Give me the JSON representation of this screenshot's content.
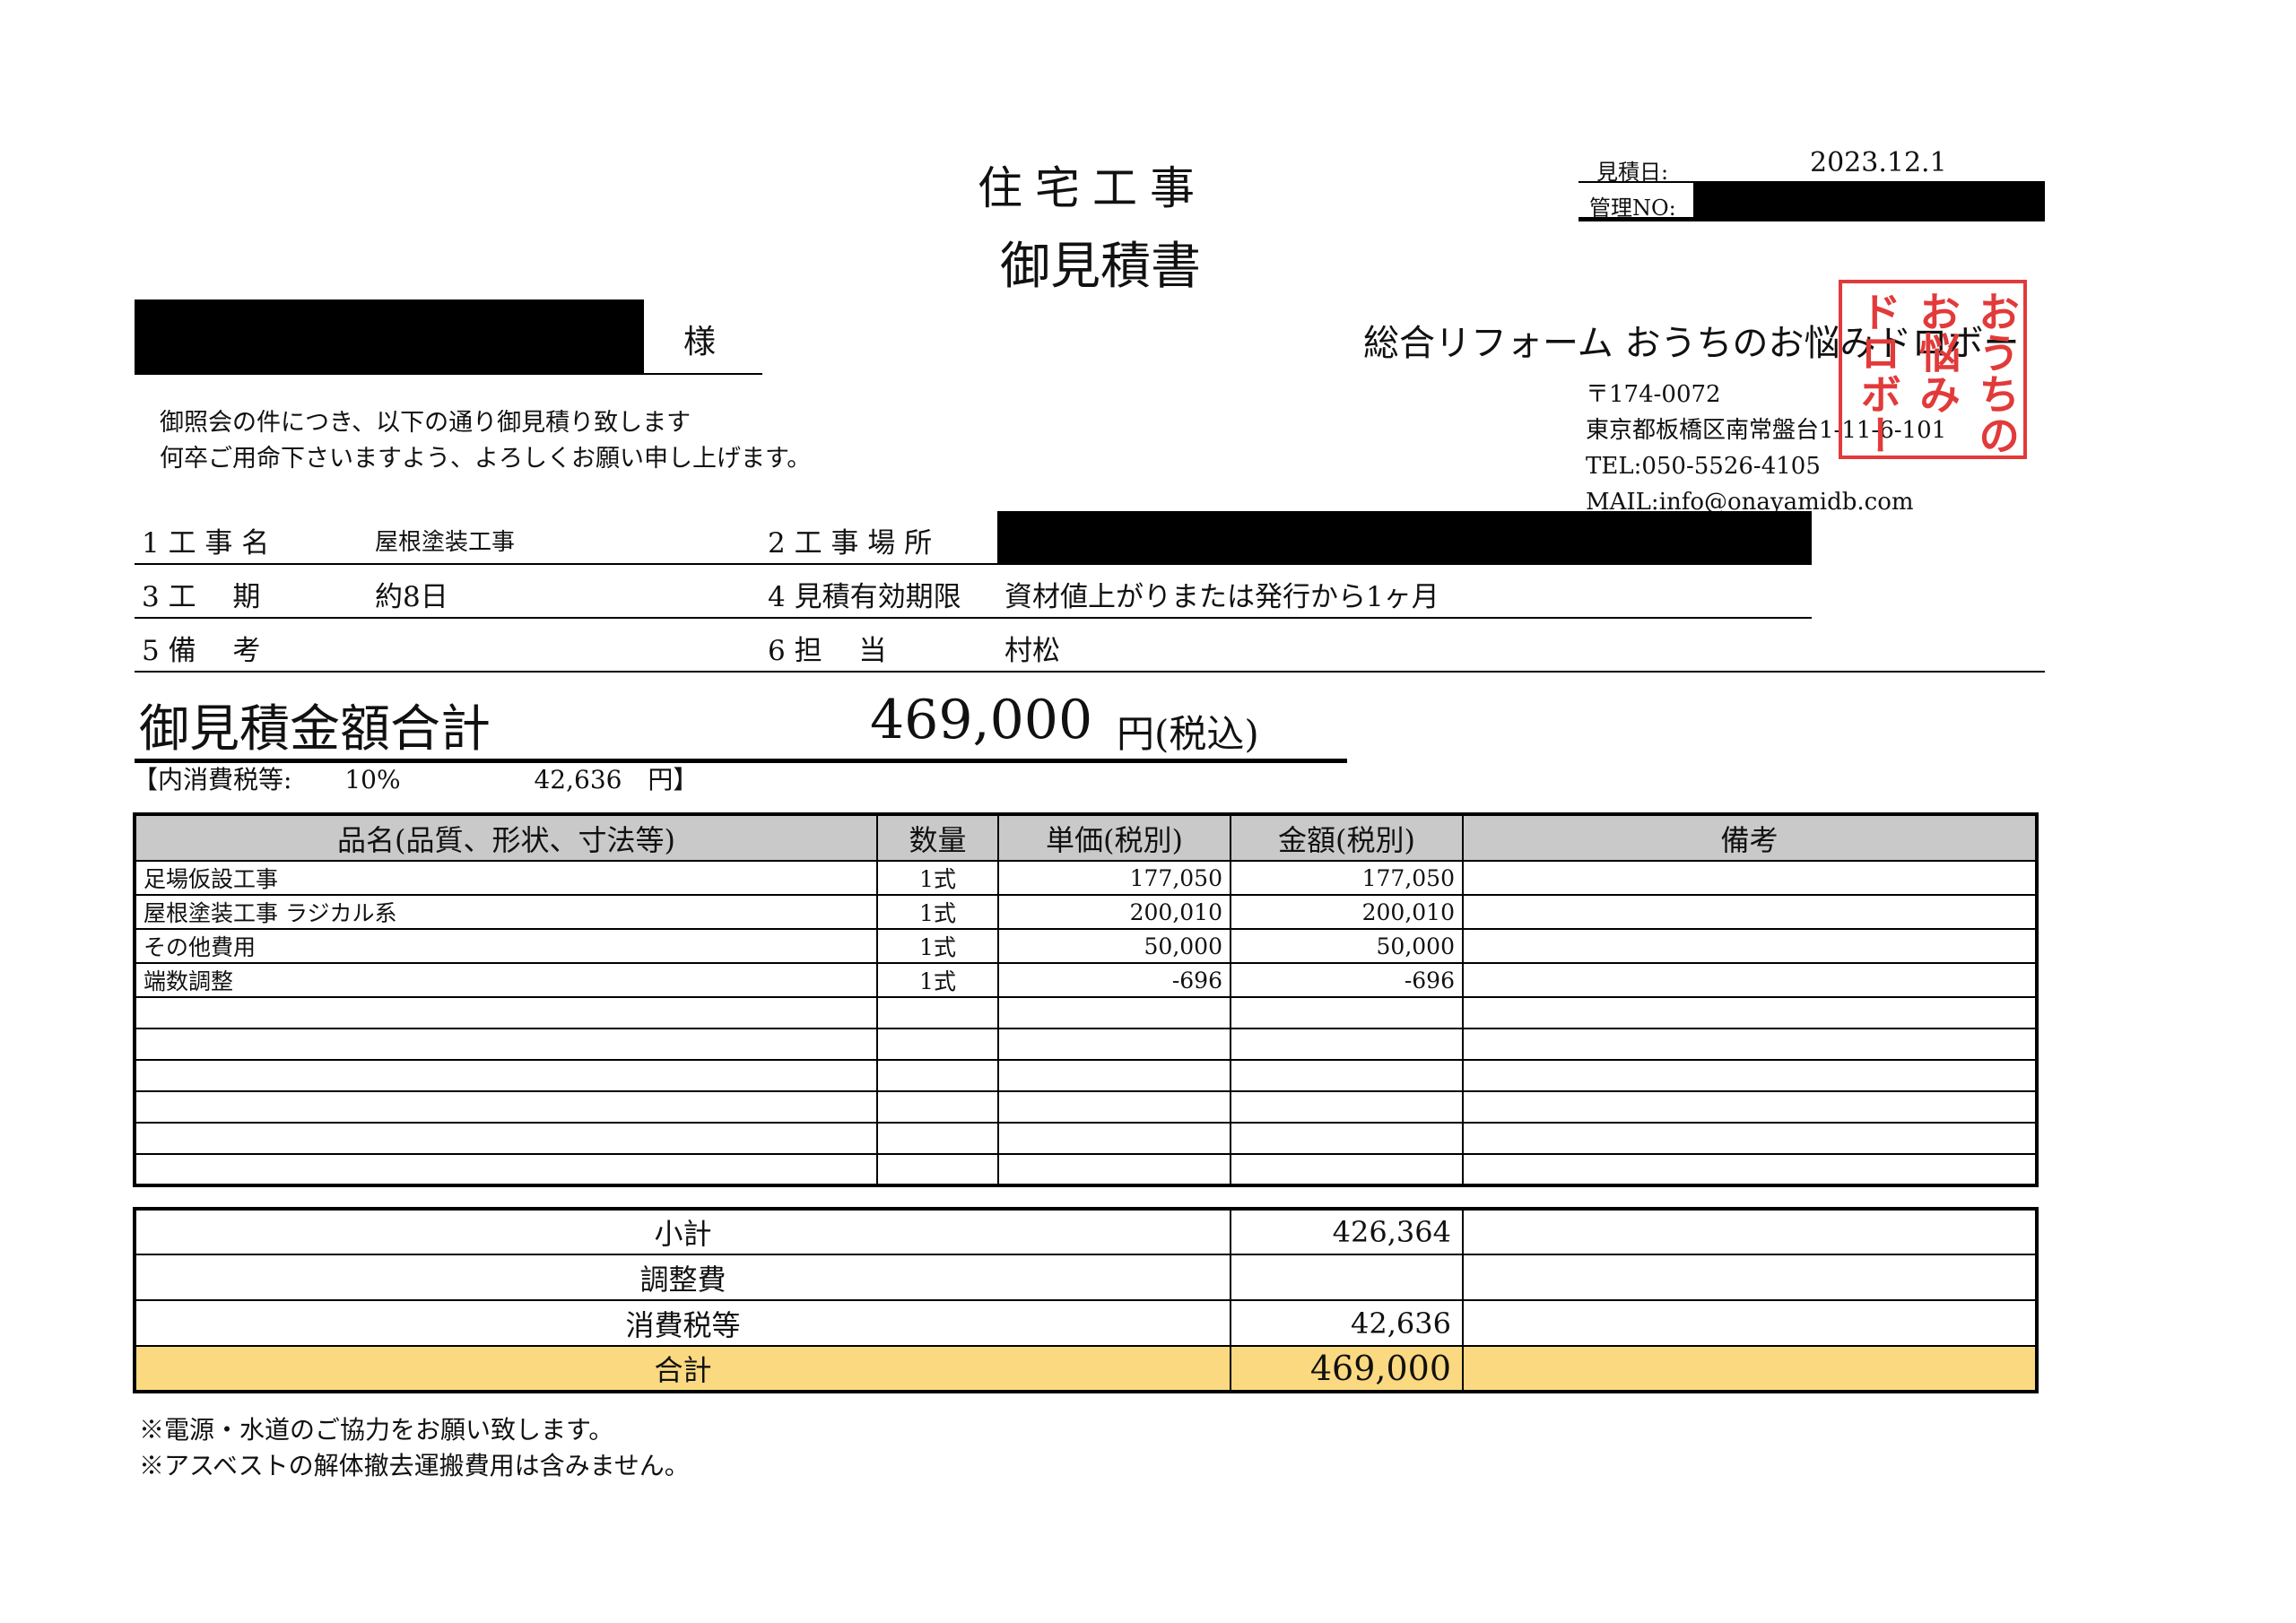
{
  "title_main": "住宅工事",
  "title_sub": "御見積書",
  "estimate_date_label": "見積日:",
  "estimate_date": "2023.12.1",
  "management_no_label": "管理NO:",
  "honorific": "様",
  "intro_lines": [
    "御照会の件につき、以下の通り御見積り致します",
    "何卒ご用命下さいますよう、よろしくお願い申し上げます。"
  ],
  "company": {
    "name": "総合リフォーム おうちのお悩みドロボー",
    "postal": "〒174-0072",
    "address": "東京都板橋区南常盤台1-11-6-101",
    "tel": "TEL:050-5526-4105",
    "mail": "MAIL:info@onayamidb.com"
  },
  "seal": {
    "columns": [
      "おうちの",
      "お悩み",
      "ドロボー"
    ],
    "color": "#e23a3a"
  },
  "info": {
    "r1_left_label": "1 工 事 名",
    "r1_left_value": "屋根塗装工事",
    "r1_right_label": "2 工 事 場 所",
    "r2_left_label": "3 工　 期",
    "r2_left_value": "約8日",
    "r2_right_label": "4 見積有効期限",
    "r2_right_value": "資材値上がりまたは発行から1ヶ月",
    "r3_left_label": "5 備　 考",
    "r3_right_label": "6 担　 当",
    "r3_right_value": "村松"
  },
  "total": {
    "label": "御見積金額合計",
    "value": "469,000",
    "unit": "円(税込)"
  },
  "tax_line": {
    "prefix": "【内消費税等:",
    "rate": "10%",
    "amount": "42,636",
    "suffix": "円】"
  },
  "table": {
    "headers": [
      "品名(品質、形状、寸法等)",
      "数量",
      "単価(税別)",
      "金額(税別)",
      "備考"
    ],
    "rows": [
      {
        "name": "足場仮設工事",
        "qty": "1式",
        "unit_price": "177,050",
        "amount": "177,050",
        "note": ""
      },
      {
        "name": "屋根塗装工事 ラジカル系",
        "qty": "1式",
        "unit_price": "200,010",
        "amount": "200,010",
        "note": ""
      },
      {
        "name": "その他費用",
        "qty": "1式",
        "unit_price": "50,000",
        "amount": "50,000",
        "note": ""
      },
      {
        "name": "端数調整",
        "qty": "1式",
        "unit_price": "-696",
        "amount": "-696",
        "note": ""
      },
      {
        "name": "",
        "qty": "",
        "unit_price": "",
        "amount": "",
        "note": ""
      },
      {
        "name": "",
        "qty": "",
        "unit_price": "",
        "amount": "",
        "note": ""
      },
      {
        "name": "",
        "qty": "",
        "unit_price": "",
        "amount": "",
        "note": ""
      },
      {
        "name": "",
        "qty": "",
        "unit_price": "",
        "amount": "",
        "note": ""
      },
      {
        "name": "",
        "qty": "",
        "unit_price": "",
        "amount": "",
        "note": ""
      },
      {
        "name": "",
        "qty": "",
        "unit_price": "",
        "amount": "",
        "note": ""
      }
    ]
  },
  "summary": [
    {
      "label": "小計",
      "value": "426,364"
    },
    {
      "label": "調整費",
      "value": ""
    },
    {
      "label": "消費税等",
      "value": "42,636"
    },
    {
      "label": "合計",
      "value": "469,000"
    }
  ],
  "highlight_color": "#fbd980",
  "notes": [
    "※電源・水道のご協力をお願い致します。",
    "※アスベストの解体撤去運搬費用は含みません。"
  ]
}
